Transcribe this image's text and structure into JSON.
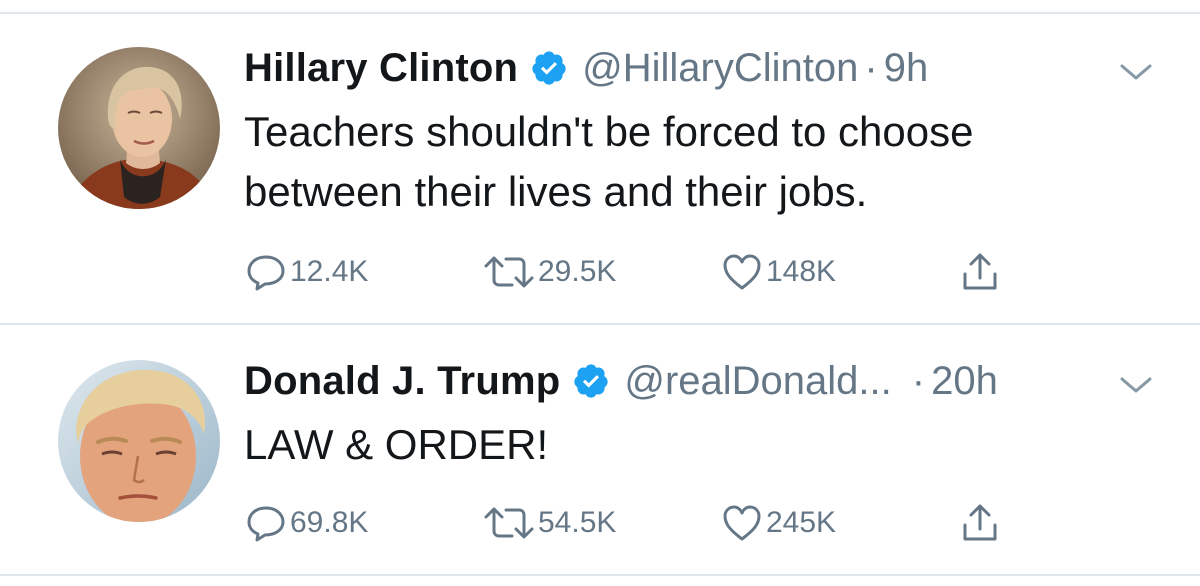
{
  "tweets": [
    {
      "name": "Hillary Clinton",
      "handle": "@HillaryClinton",
      "separator": "·",
      "time": "9h",
      "text_lines": [
        "Teachers shouldn't be forced to choose",
        "between their lives and their jobs."
      ],
      "replies": "12.4K",
      "retweets": "29.5K",
      "likes": "148K",
      "verified": true
    },
    {
      "name": "Donald J. Trump",
      "handle": "@realDonald...",
      "separator": "·",
      "time": "20h",
      "text_lines": [
        "LAW & ORDER!"
      ],
      "replies": "69.8K",
      "retweets": "54.5K",
      "likes": "245K",
      "verified": true
    }
  ],
  "icons": {
    "reply": "reply-icon",
    "retweet": "retweet-icon",
    "like": "heart-icon",
    "share": "share-icon",
    "verified": "verified-badge-icon",
    "more": "chevron-down-icon"
  },
  "colors": {
    "verified_blue": "#1da1f2",
    "secondary_text": "#657786",
    "divider": "#e1e8ed",
    "primary_text": "#14171a"
  }
}
